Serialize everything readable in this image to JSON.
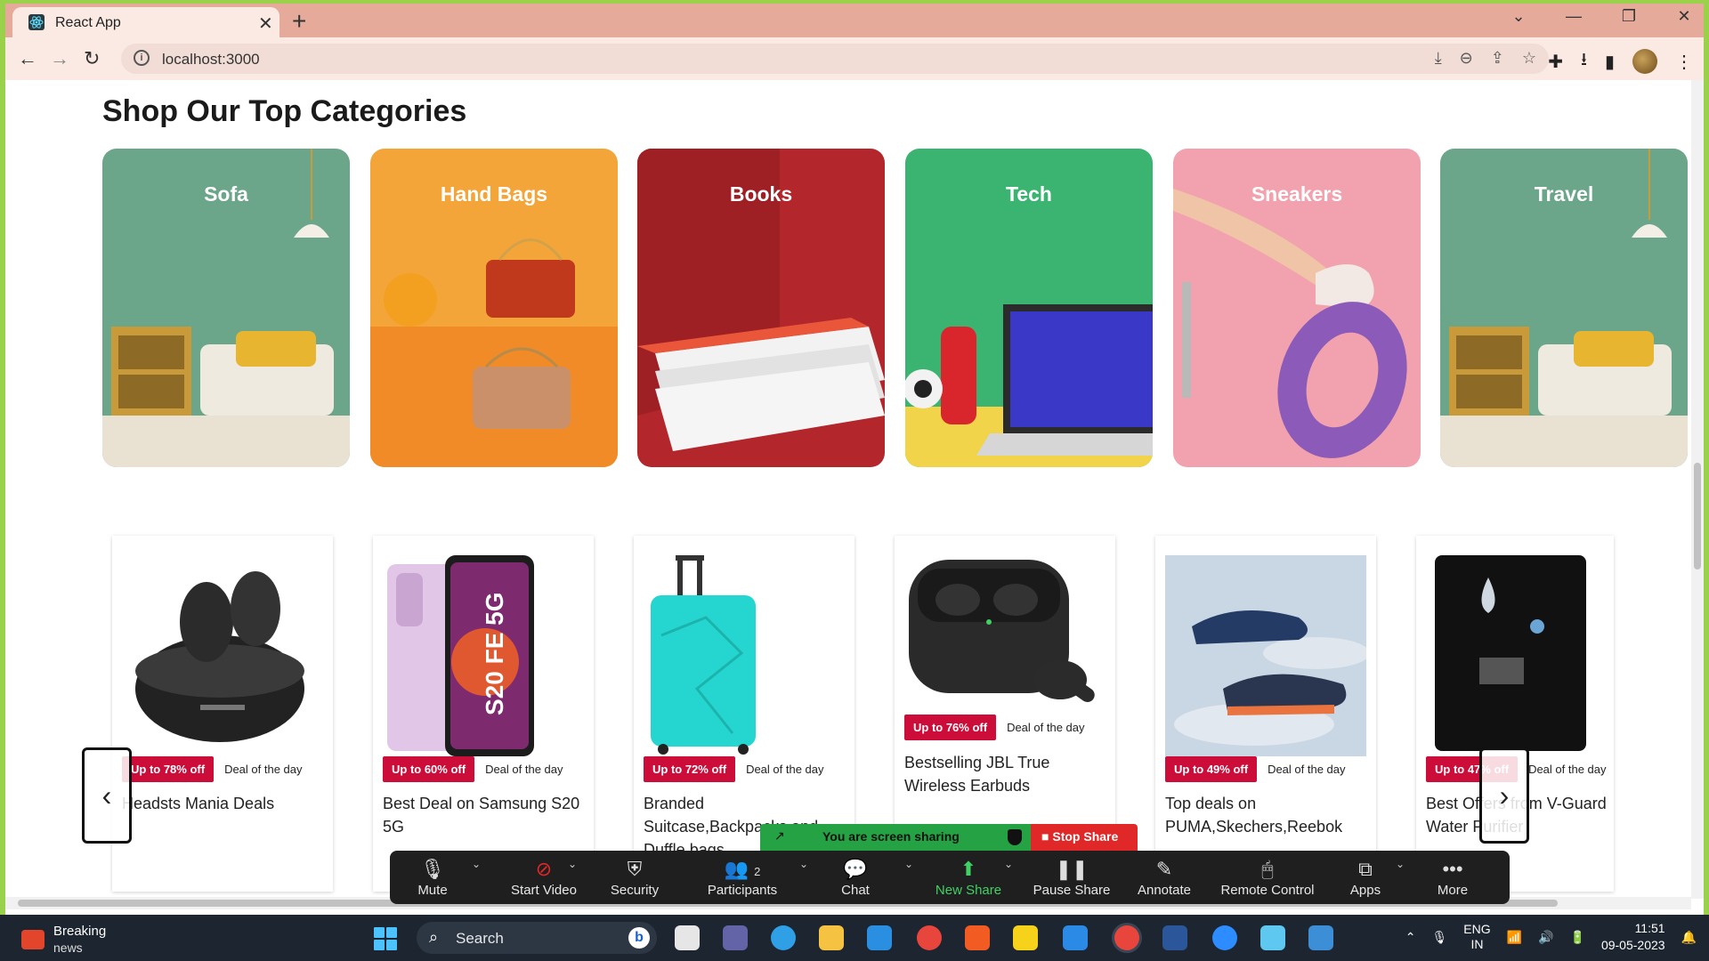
{
  "browser": {
    "tab_title": "React App",
    "url": "localhost:3000"
  },
  "page": {
    "section_title": "Shop Our Top Categories",
    "categories": [
      {
        "label": "Sofa",
        "bg": "#6ba58a"
      },
      {
        "label": "Hand Bags",
        "bg": "#f4a53a"
      },
      {
        "label": "Books",
        "bg": "#b3262b"
      },
      {
        "label": "Tech",
        "bg": "#3bb371"
      },
      {
        "label": "Sneakers",
        "bg": "#f2a2ae"
      },
      {
        "label": "Travel",
        "bg": "#6ba58a"
      }
    ],
    "deals": [
      {
        "badge": "Up to 78% off",
        "tag": "Deal of the day",
        "title": "Headsts Mania Deals",
        "icon": "earbuds-image"
      },
      {
        "badge": "Up to 60% off",
        "tag": "Deal of the day",
        "title": "Best Deal on Samsung S20 5G",
        "icon": "phone-image"
      },
      {
        "badge": "Up to 72% off",
        "tag": "Deal of the day",
        "title": "Branded Suitcase,Backpacks and Duffle bags",
        "icon": "suitcase-image"
      },
      {
        "badge": "Up to 76% off",
        "tag": "Deal of the day",
        "title": "Bestselling JBL True Wireless Earbuds",
        "icon": "jbl-earbuds-image"
      },
      {
        "badge": "Up to 49% off",
        "tag": "Deal of the day",
        "title": "Top deals on PUMA,Skechers,Reebok",
        "icon": "shoes-image"
      },
      {
        "badge": "Up to 47% off",
        "tag": "Deal of the day",
        "title": "Best Offers from V-Guard Water Purifier",
        "icon": "purifier-image"
      }
    ],
    "colors": {
      "badge": "#cc0c39",
      "share_green": "#25a243",
      "stop_red": "#e02828"
    }
  },
  "zoom": {
    "sharing_text": "You are screen sharing",
    "stop_share": "Stop Share",
    "participants_count": "2",
    "items": [
      {
        "label": "Mute",
        "icon": "microphone-icon"
      },
      {
        "label": "Start Video",
        "icon": "video-off-icon"
      },
      {
        "label": "Security",
        "icon": "shield-icon"
      },
      {
        "label": "Participants",
        "icon": "people-icon"
      },
      {
        "label": "Chat",
        "icon": "chat-icon"
      },
      {
        "label": "New Share",
        "icon": "share-up-icon"
      },
      {
        "label": "Pause Share",
        "icon": "pause-icon"
      },
      {
        "label": "Annotate",
        "icon": "pencil-icon"
      },
      {
        "label": "Remote Control",
        "icon": "mouse-icon"
      },
      {
        "label": "Apps",
        "icon": "apps-icon"
      },
      {
        "label": "More",
        "icon": "more-icon"
      }
    ]
  },
  "taskbar": {
    "news_title": "Breaking",
    "news_sub": "news",
    "search_placeholder": "Search",
    "lang_top": "ENG",
    "lang_bottom": "IN",
    "time": "11:51",
    "date": "09-05-2023"
  }
}
